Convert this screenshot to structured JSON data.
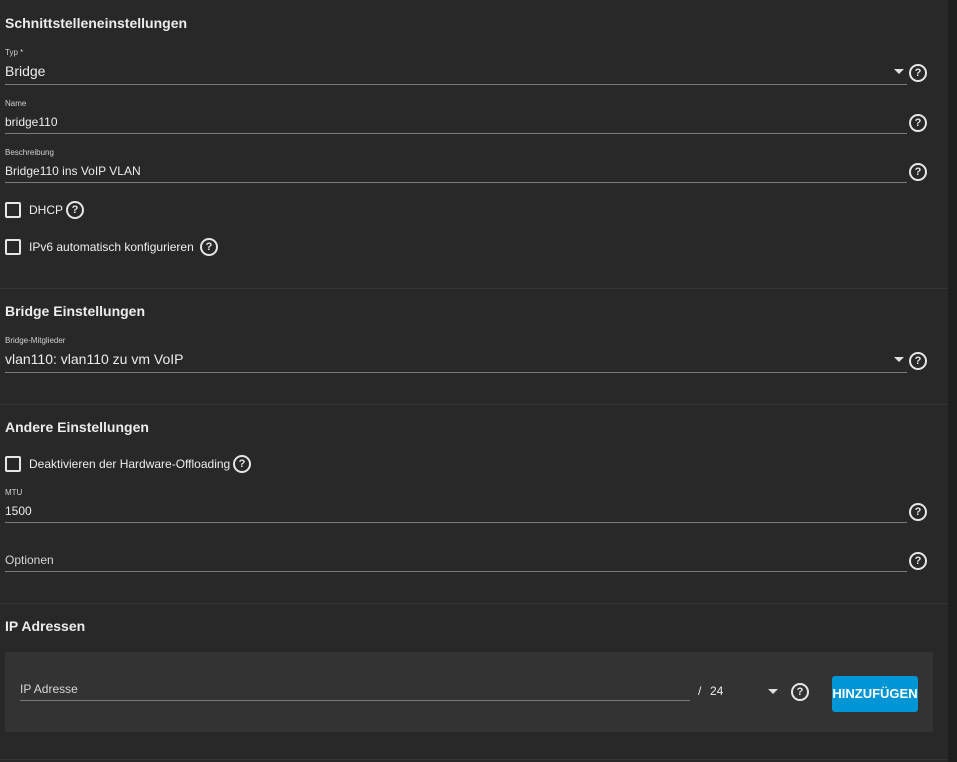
{
  "interface_settings": {
    "title": "Schnittstelleneinstellungen",
    "type": {
      "label": "Typ *",
      "value": "Bridge"
    },
    "name": {
      "label": "Name",
      "value": "bridge110"
    },
    "description": {
      "label": "Beschreibung",
      "value": "Bridge110 ins VoIP VLAN"
    },
    "dhcp": {
      "label": "DHCP",
      "checked": false
    },
    "ipv6_auto": {
      "label": "IPv6 automatisch konfigurieren",
      "checked": false
    }
  },
  "bridge_settings": {
    "title": "Bridge Einstellungen",
    "members": {
      "label": "Bridge-Mitglieder",
      "value": "vlan110: vlan110 zu vm VoIP"
    }
  },
  "other_settings": {
    "title": "Andere Einstellungen",
    "disable_hw_offloading": {
      "label": "Deaktivieren der Hardware-Offloading",
      "checked": false
    },
    "mtu": {
      "label": "MTU",
      "value": "1500"
    },
    "options": {
      "placeholder": "Optionen"
    }
  },
  "ip_addresses": {
    "title": "IP Adressen",
    "address": {
      "placeholder": "IP Adresse"
    },
    "separator": "/",
    "netmask": "24",
    "add_button": "HINZUFÜGEN"
  },
  "icons": {
    "help": "?"
  },
  "colors": {
    "background": "#282828",
    "accent": "#0095d5",
    "text": "#ececec"
  }
}
